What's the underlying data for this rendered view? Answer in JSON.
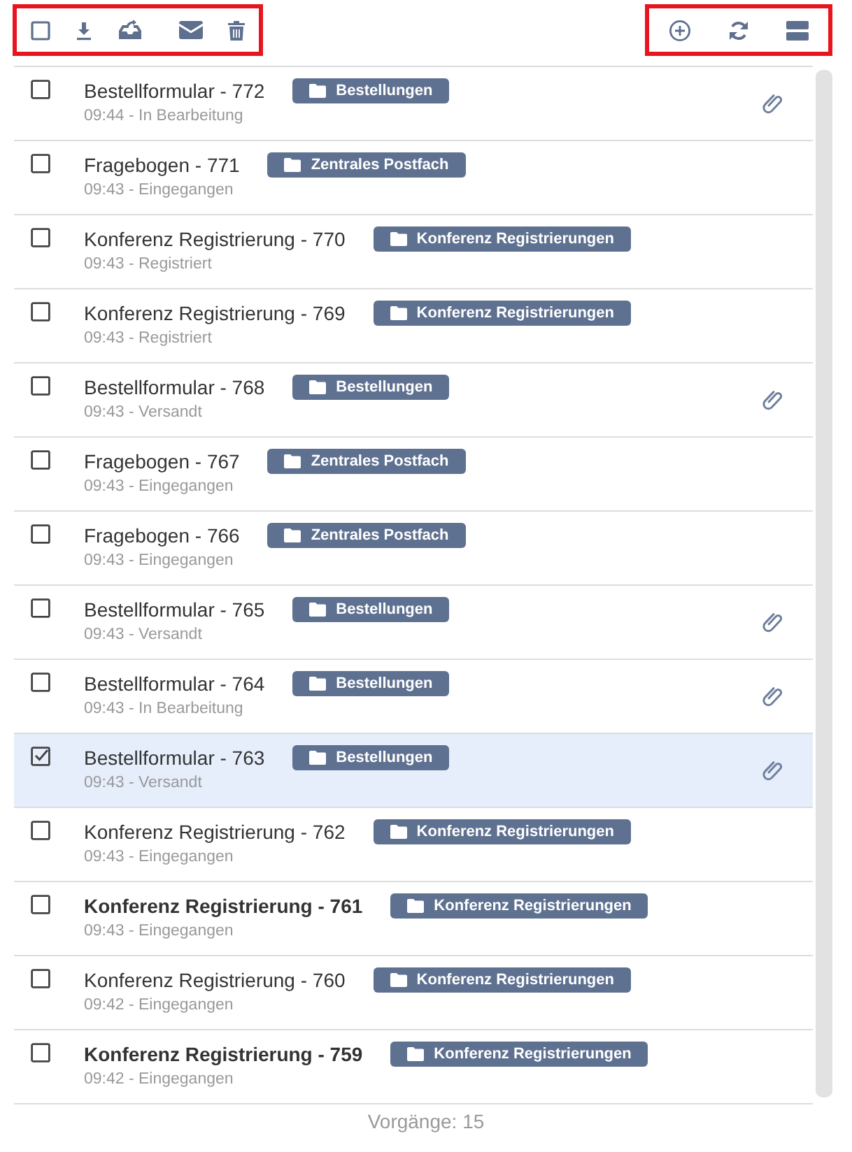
{
  "toolbar": {
    "left_highlighted": true,
    "right_highlighted": true
  },
  "items": [
    {
      "title": "Bestellformular - 772",
      "folder": "Bestellungen",
      "subtitle": "09:44 - In Bearbeitung",
      "attachment": true,
      "unread": false,
      "selected": false,
      "checked": false
    },
    {
      "title": "Fragebogen - 771",
      "folder": "Zentrales Postfach",
      "subtitle": "09:43 - Eingegangen",
      "attachment": false,
      "unread": false,
      "selected": false,
      "checked": false
    },
    {
      "title": "Konferenz Registrierung - 770",
      "folder": "Konferenz Registrierungen",
      "subtitle": "09:43 - Registriert",
      "attachment": false,
      "unread": false,
      "selected": false,
      "checked": false
    },
    {
      "title": "Konferenz Registrierung - 769",
      "folder": "Konferenz Registrierungen",
      "subtitle": "09:43 - Registriert",
      "attachment": false,
      "unread": false,
      "selected": false,
      "checked": false
    },
    {
      "title": "Bestellformular - 768",
      "folder": "Bestellungen",
      "subtitle": "09:43 - Versandt",
      "attachment": true,
      "unread": false,
      "selected": false,
      "checked": false
    },
    {
      "title": "Fragebogen - 767",
      "folder": "Zentrales Postfach",
      "subtitle": "09:43 - Eingegangen",
      "attachment": false,
      "unread": false,
      "selected": false,
      "checked": false
    },
    {
      "title": "Fragebogen - 766",
      "folder": "Zentrales Postfach",
      "subtitle": "09:43 - Eingegangen",
      "attachment": false,
      "unread": false,
      "selected": false,
      "checked": false
    },
    {
      "title": "Bestellformular - 765",
      "folder": "Bestellungen",
      "subtitle": "09:43 - Versandt",
      "attachment": true,
      "unread": false,
      "selected": false,
      "checked": false
    },
    {
      "title": "Bestellformular - 764",
      "folder": "Bestellungen",
      "subtitle": "09:43 - In Bearbeitung",
      "attachment": true,
      "unread": false,
      "selected": false,
      "checked": false
    },
    {
      "title": "Bestellformular - 763",
      "folder": "Bestellungen",
      "subtitle": "09:43 - Versandt",
      "attachment": true,
      "unread": false,
      "selected": true,
      "checked": true
    },
    {
      "title": "Konferenz Registrierung - 762",
      "folder": "Konferenz Registrierungen",
      "subtitle": "09:43 - Eingegangen",
      "attachment": false,
      "unread": false,
      "selected": false,
      "checked": false
    },
    {
      "title": "Konferenz Registrierung - 761",
      "folder": "Konferenz Registrierungen",
      "subtitle": "09:43 - Eingegangen",
      "attachment": false,
      "unread": true,
      "selected": false,
      "checked": false
    },
    {
      "title": "Konferenz Registrierung - 760",
      "folder": "Konferenz Registrierungen",
      "subtitle": "09:42 - Eingegangen",
      "attachment": false,
      "unread": false,
      "selected": false,
      "checked": false
    },
    {
      "title": "Konferenz Registrierung - 759",
      "folder": "Konferenz Registrierungen",
      "subtitle": "09:42 - Eingegangen",
      "attachment": false,
      "unread": true,
      "selected": false,
      "checked": false
    }
  ],
  "footer": "Vorgänge: 15"
}
